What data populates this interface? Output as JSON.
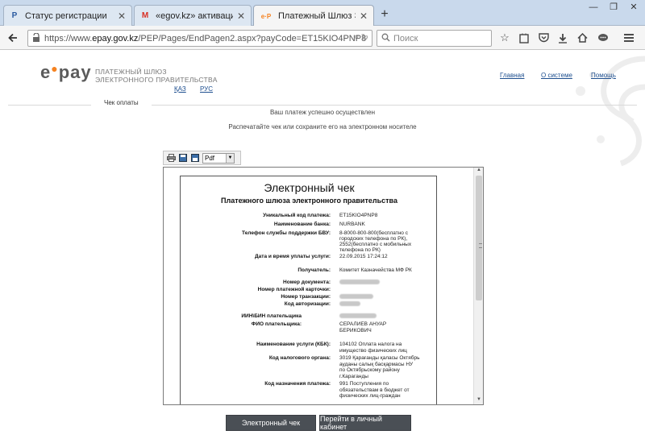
{
  "browser": {
    "tabs": [
      {
        "title": "Статус регистрации",
        "icon": "p-icon",
        "glyph": "P",
        "active": false
      },
      {
        "title": "«egov.kz» активация акка...",
        "icon": "gmail-icon",
        "glyph": "M",
        "active": false
      },
      {
        "title": "Платежный Шлюз Электр...",
        "icon": "epay-icon",
        "glyph": "e·P",
        "active": true
      }
    ],
    "new_tab": "+",
    "url_prefix": "https://www.",
    "url_host": "epay.gov.kz",
    "url_path": "/PEP/Pages/EndPagen2.aspx?payCode=ET15KIO4PNP8",
    "search_placeholder": "Поиск"
  },
  "site": {
    "logo_e": "e",
    "logo_pay": "pay",
    "tagline_1": "ПЛАТЕЖНЫЙ ШЛЮЗ",
    "tagline_2": "ЭЛЕКТРОННОГО ПРАВИТЕЛЬСТВА",
    "lang_kaz": "ҚАЗ",
    "lang_rus": "РУС",
    "nav": [
      "Главная",
      "О системе",
      "Помощь"
    ],
    "section_label": "Чек оплаты",
    "msg_success": "Ваш платеж успешно осуществлен",
    "msg_print": "Распечатайте чек или сохраните его на электронном носителе"
  },
  "viewer": {
    "format_value": "Pdf"
  },
  "receipt": {
    "title": "Электронный чек",
    "subtitle": "Платежного шлюза электронного правительства",
    "rows": [
      {
        "label": "Уникальный код платежа:",
        "value": "ET15KIO4PNP8"
      },
      {
        "label": "Наименование банка:",
        "value": "NURBANK"
      },
      {
        "label": "Телефон службы поддержки БВУ:",
        "value": "8-8000-800-800(бесплатно с городских телефона по РК), 2552(бесплатно с мобильных телефона по РК)"
      },
      {
        "label": "Дата и время уплаты услуги:",
        "value": "22.09.2015 17:24:12"
      },
      {
        "label": "Получатель:",
        "value": "Комитет Казначейства МФ РК"
      },
      {
        "label": "Номер документа:",
        "value": ""
      },
      {
        "label": "Номер платежной карточки:",
        "value": ""
      },
      {
        "label": "Номер транзакции:",
        "value": ""
      },
      {
        "label": "Код авторизации:",
        "value": ""
      },
      {
        "label": "ИИН\\БИН плательщика",
        "value": ""
      },
      {
        "label": "ФИО плательщика:",
        "value": "СЕРАЛИЕВ АНУАР БЕРИКОВИЧ"
      },
      {
        "label": "Наименование услуги (КБК):",
        "value": "104102 Оплата налога на имущество физических лиц"
      },
      {
        "label": "Код налогового органа:",
        "value": "3019 Қарағанды қаласы Октябрь ауданы салық басқармасы НУ по Октябрьскому району г.Караганды"
      },
      {
        "label": "Код назначения платежа:",
        "value": "991 Поступления по обязательствам в бюджет от физических лиц-граждан"
      }
    ]
  },
  "buttons": {
    "receipt": "Электронный чек",
    "cabinet": "Перейти в личный кабинет"
  }
}
